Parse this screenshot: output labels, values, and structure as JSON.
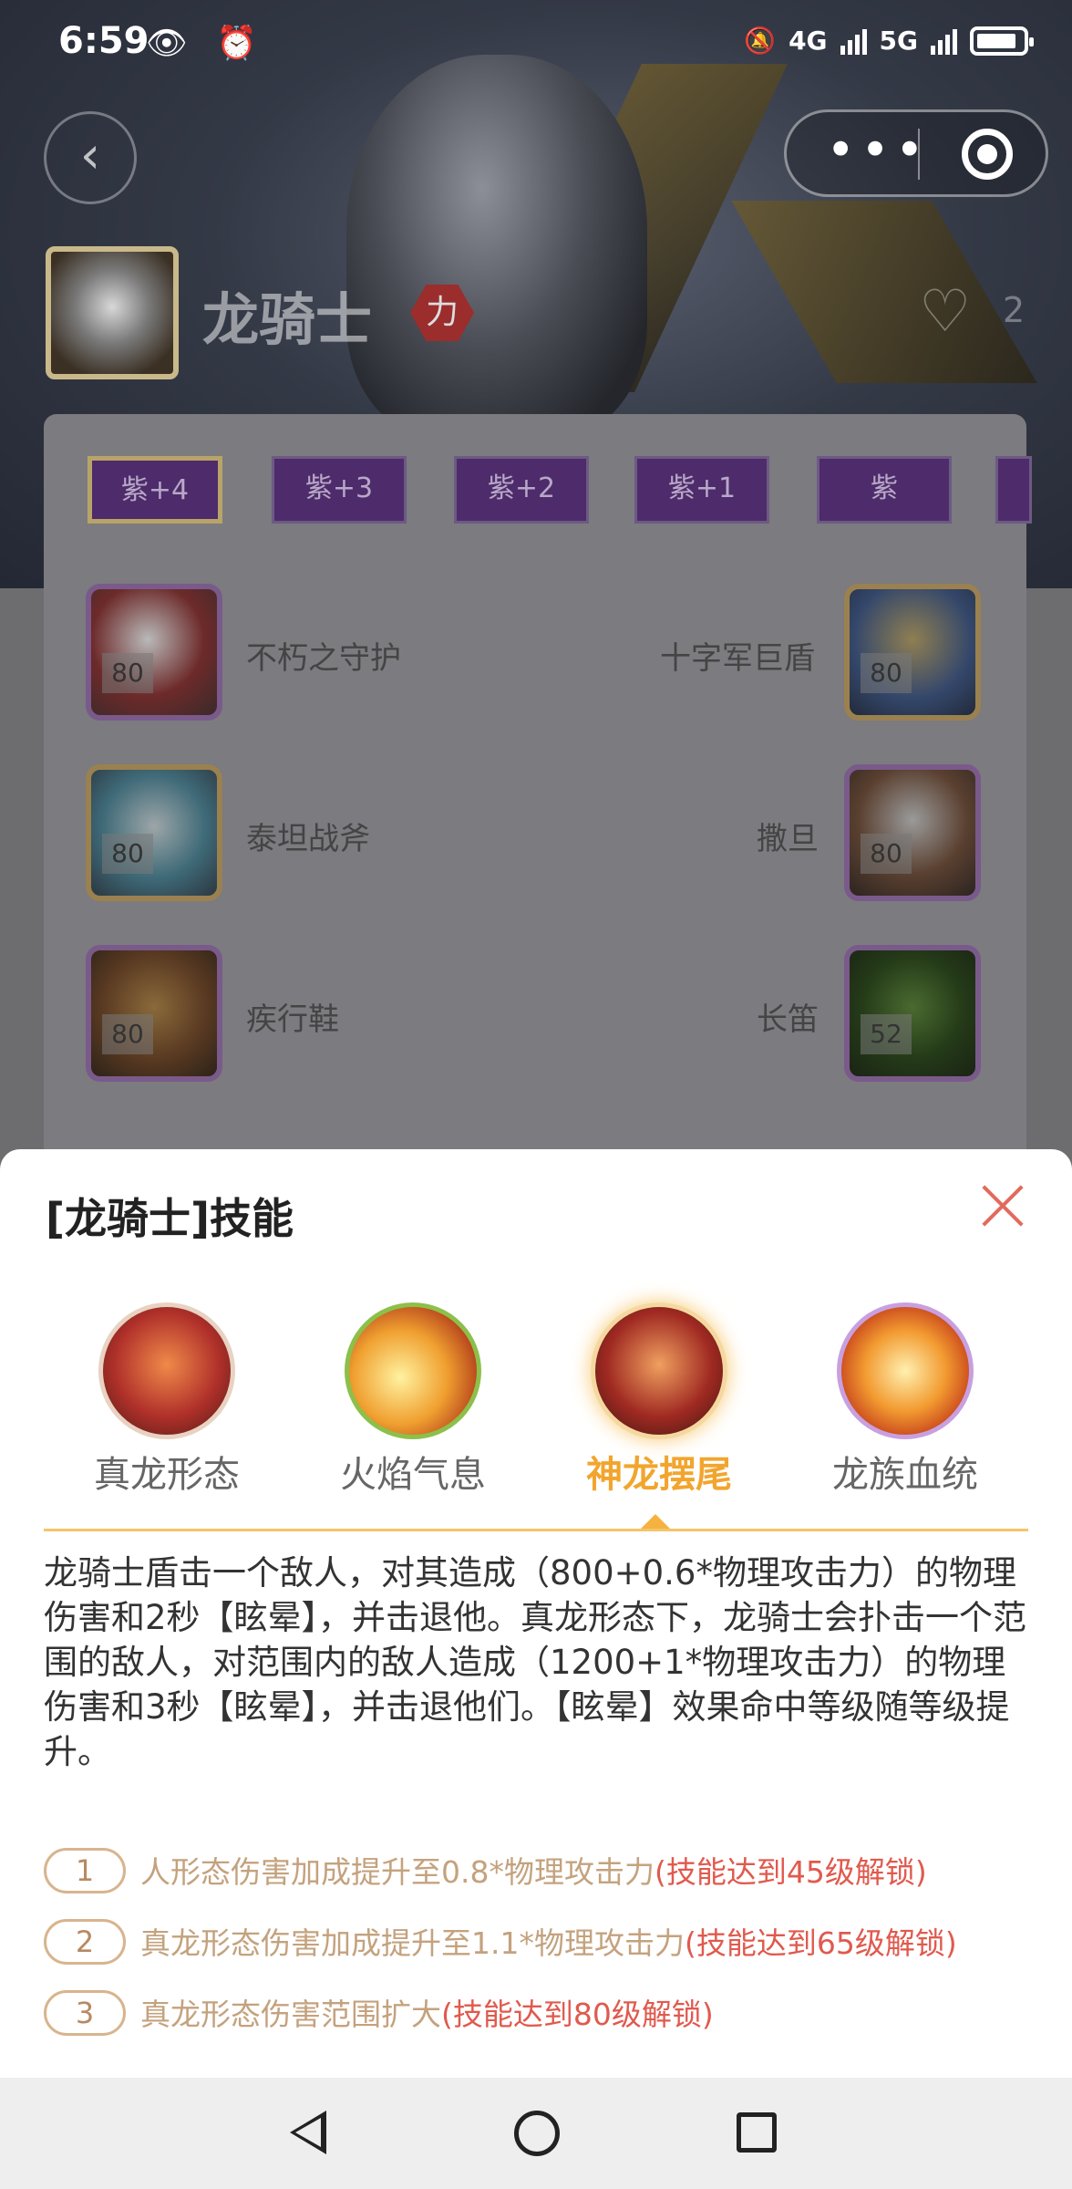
{
  "status_bar": {
    "time": "6:59",
    "left_icons": "👁 ⏰",
    "net1": "4G",
    "net2": "5G"
  },
  "hero": {
    "name": "龙骑士",
    "badge": "力",
    "like_count": "2"
  },
  "grade_tabs": [
    "紫+4",
    "紫+3",
    "紫+2",
    "紫+1",
    "紫"
  ],
  "equipment": [
    {
      "name": "不朽之守护",
      "level": "80"
    },
    {
      "name": "十字军巨盾",
      "level": "80"
    },
    {
      "name": "泰坦战斧",
      "level": "80"
    },
    {
      "name": "撒旦",
      "level": "80"
    },
    {
      "name": "疾行鞋",
      "level": "80"
    },
    {
      "name": "长笛",
      "level": "52"
    }
  ],
  "sheet": {
    "title": "[龙骑士]技能",
    "skills": [
      {
        "label": "真龙形态"
      },
      {
        "label": "火焰气息"
      },
      {
        "label": "神龙摆尾"
      },
      {
        "label": "龙族血统"
      }
    ],
    "active_skill": "神龙摆尾",
    "description": "龙骑士盾击一个敌人，对其造成（800+0.6*物理攻击力）的物理伤害和2秒【眩晕】，并击退他。真龙形态下，龙骑士会扑击一个范围的敌人，对范围内的敌人造成（1200+1*物理攻击力）的物理伤害和3秒【眩晕】，并击退他们。【眩晕】效果命中等级随等级提升。",
    "unlocks": [
      {
        "num": "1",
        "text": "人形态伤害加成提升至0.8*物理攻击力",
        "req": "(技能达到45级解锁)"
      },
      {
        "num": "2",
        "text": "真龙形态伤害加成提升至1.1*物理攻击力",
        "req": "(技能达到65级解锁)"
      },
      {
        "num": "3",
        "text": "真龙形态伤害范围扩大",
        "req": "(技能达到80级解锁)"
      }
    ]
  },
  "colors": {
    "accent": "#f2a52e",
    "unlock_text": "#c4a27e",
    "unlock_req": "#e05a4e",
    "close": "#e26a5c"
  },
  "icons": {
    "back": "chevron-left-icon",
    "more": "more-dots-icon",
    "target": "target-icon",
    "like": "heart-icon",
    "close": "close-icon",
    "nav_back": "triangle-back-icon",
    "nav_home": "circle-home-icon",
    "nav_recent": "square-recent-icon"
  }
}
